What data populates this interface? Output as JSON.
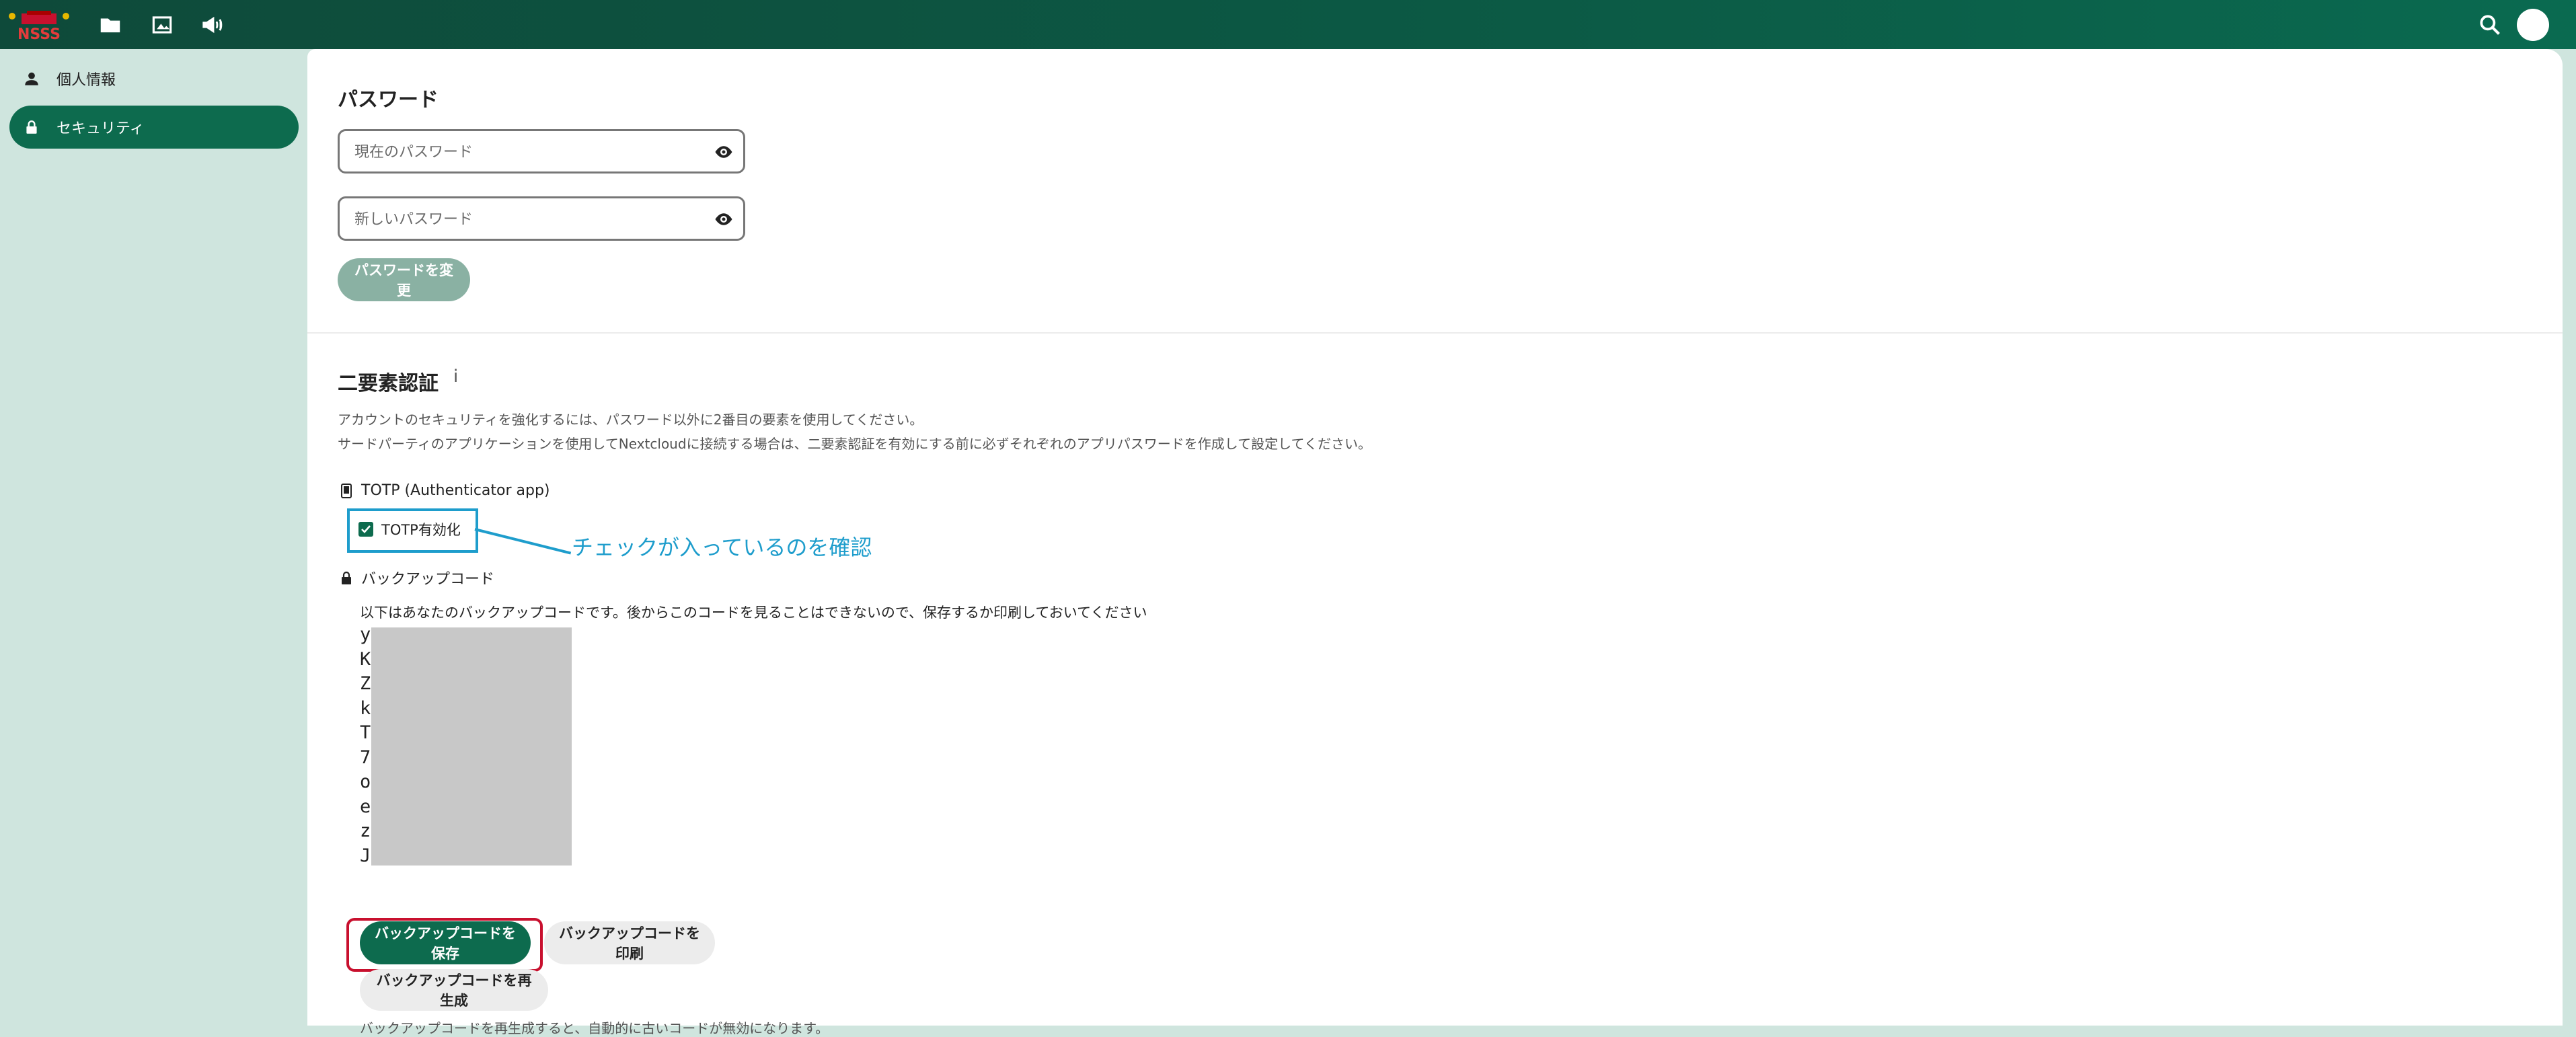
{
  "header": {
    "logo_text": "NSSS",
    "icons": [
      "files-icon",
      "photos-icon",
      "announcements-icon"
    ],
    "search_icon": "search-icon"
  },
  "sidebar": {
    "items": [
      {
        "label": "個人情報",
        "icon": "person-icon",
        "active": false
      },
      {
        "label": "セキュリティ",
        "icon": "lock-icon",
        "active": true
      }
    ]
  },
  "password": {
    "title": "パスワード",
    "current_placeholder": "現在のパスワード",
    "current_value": "",
    "new_placeholder": "新しいパスワード",
    "new_value": "",
    "change_button": "パスワードを変更"
  },
  "twofa": {
    "title": "二要素認証",
    "info_glyph": "i",
    "desc1": "アカウントのセキュリティを強化するには、パスワード以外に2番目の要素を使用してください。",
    "desc2": "サードパーティのアプリケーションを使用してNextcloudに接続する場合は、二要素認証を有効にする前に必ずそれぞれのアプリパスワードを作成して設定してください。",
    "totp_label": "TOTP (Authenticator app)",
    "totp_checkbox_label": "TOTP有効化",
    "totp_checked": true,
    "backup_label": "バックアップコード",
    "backup_intro": "以下はあなたのバックアップコードです。後からこのコードを見ることはできないので、保存するか印刷しておいてください",
    "backup_codes_visible_chars": [
      "y",
      "K",
      "Z",
      "k",
      "T",
      "7",
      "o",
      "e",
      "z",
      "J"
    ],
    "save_button": "バックアップコードを保存",
    "print_button": "バックアップコードを印刷",
    "regen_button": "バックアップコードを再生成",
    "regen_note": "バックアップコードを再生成すると、自動的に古いコードが無効になります。"
  },
  "annotation": {
    "text": "チェックが入っているのを確認",
    "color_blue": "#1e9dcc",
    "color_red": "#c8102e"
  },
  "colors": {
    "primary": "#0d6b4e",
    "header": "#0e4a3a",
    "sidebar_bg": "#cfe5de"
  }
}
